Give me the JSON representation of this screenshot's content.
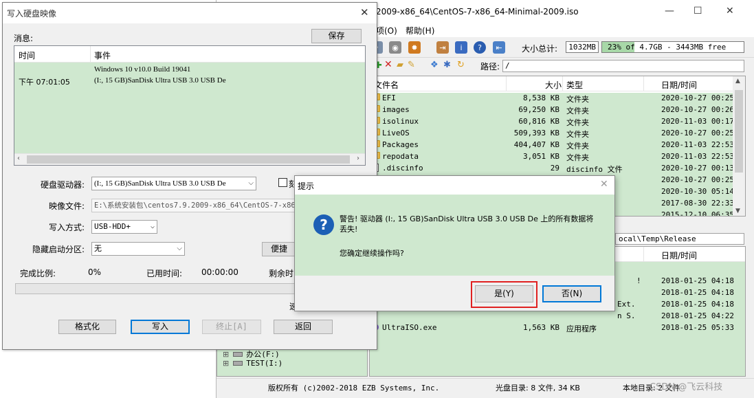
{
  "main_window": {
    "title": "2009-x86_64\\CentOS-7-x86_64-Minimal-2009.iso",
    "controls": {
      "minimize": "—",
      "maximize": "☐",
      "close": "✕"
    },
    "menu": [
      "项(O)",
      "帮助(H)"
    ],
    "size_label": "大小总计:",
    "size_value": "1032MB",
    "size_bar_text": "23% of 4.7GB - 3443MB free",
    "size_bar_fraction": 0.23,
    "path_label": "路径:",
    "path_value": "/",
    "file_columns": {
      "name": "文件名",
      "size": "大小",
      "type": "类型",
      "date": "日期/时间"
    },
    "files": [
      {
        "name": "EFI",
        "size": "8,538 KB",
        "type": "文件夹",
        "date": "2020-10-27 00:25",
        "icon": "folder-icon"
      },
      {
        "name": "images",
        "size": "69,250 KB",
        "type": "文件夹",
        "date": "2020-10-27 00:26",
        "icon": "folder-icon"
      },
      {
        "name": "isolinux",
        "size": "60,816 KB",
        "type": "文件夹",
        "date": "2020-11-03 00:17",
        "icon": "folder-icon"
      },
      {
        "name": "LiveOS",
        "size": "509,393 KB",
        "type": "文件夹",
        "date": "2020-10-27 00:25",
        "icon": "folder-icon"
      },
      {
        "name": "Packages",
        "size": "404,407 KB",
        "type": "文件夹",
        "date": "2020-11-03 22:53",
        "icon": "folder-icon"
      },
      {
        "name": "repodata",
        "size": "3,051 KB",
        "type": "文件夹",
        "date": "2020-11-03 22:53",
        "icon": "folder-icon"
      },
      {
        "name": ".discinfo",
        "size": "29",
        "type": "discinfo 文件",
        "date": "2020-10-27 00:13",
        "icon": "file-icon"
      },
      {
        "name": "",
        "size": "",
        "type": "F",
        "date": "2020-10-27 00:25",
        "icon": ""
      },
      {
        "name": "",
        "size": "",
        "type": "",
        "date": "2020-10-30 05:14",
        "icon": ""
      },
      {
        "name": "",
        "size": "",
        "type": "",
        "date": "2017-08-30 22:33",
        "icon": ""
      },
      {
        "name": "",
        "size": "",
        "type": "",
        "date": "2015-12-10 06:35",
        "icon": ""
      }
    ],
    "lower_path": "ocal\\Temp\\Release",
    "lower_date_header": "日期/时间",
    "lower_rows": [
      {
        "name": "",
        "size": "",
        "type": "!",
        "date": "2018-01-25 04:18"
      },
      {
        "name": "",
        "size": "",
        "type": "",
        "date": "2018-01-25 04:18"
      },
      {
        "name": "",
        "size": "",
        "type": "Ext.",
        "date": "2018-01-25 04:18"
      },
      {
        "name": "",
        "size": "",
        "type": "n S.",
        "date": "2018-01-25 04:22"
      },
      {
        "name": "UltraISO.exe",
        "size": "1,563 KB",
        "type": "应用程序",
        "date": "2018-01-25 05:33"
      }
    ],
    "tree": [
      "办公(F:)",
      "TEST(I:)"
    ],
    "status": {
      "copyright": "版权所有 (c)2002-2018 EZB Systems, Inc.",
      "disc_dir": "光盘目录: 8 文件, 34 KB",
      "local_dir": "本地目录: 2 文件"
    }
  },
  "write_dialog": {
    "title": "写入硬盘映像",
    "close": "✕",
    "msg_label": "消息:",
    "save_button": "保存",
    "log_columns": {
      "time": "时间",
      "event": "事件"
    },
    "log_time": "下午 07:01:05",
    "log_line1": "Windows 10 v10.0 Build 19041",
    "log_line2": "(I:, 15 GB)SanDisk Ultra USB 3.0 USB De",
    "drive_label": "硬盘驱动器:",
    "drive_value": "(I:, 15 GB)SanDisk Ultra USB 3.0 USB De",
    "verify_label": "刻",
    "image_label": "映像文件:",
    "image_value": "E:\\系统安装包\\centos7.9.2009-x86_64\\CentOS-7-x86_",
    "method_label": "写入方式:",
    "method_value": "USB-HDD+",
    "hidden_label": "隐藏启动分区:",
    "hidden_value": "无",
    "convenience_button": "便捷",
    "done_label": "完成比例:",
    "done_value": "0%",
    "elapsed_label": "已用时间:",
    "elapsed_value": "00:00:00",
    "remaining_label": "剩余时",
    "speed_label": "速",
    "progress": 0,
    "buttons": {
      "format": "格式化",
      "write": "写入",
      "stop": "终止[A]",
      "back": "返回"
    }
  },
  "confirm_dialog": {
    "title": "提示",
    "close": "✕",
    "icon": "question-icon",
    "warning": "警告! 驱动器 (I:, 15 GB)SanDisk Ultra USB 3.0 USB De 上的所有数据将丢失!",
    "question": "您确定继续操作吗?",
    "yes": "是(Y)",
    "no": "否(N)"
  },
  "watermark": "CSDN @飞云科技",
  "colors": {
    "row_green": "#cfe8cf",
    "highlight_red": "#e02020",
    "accent_blue": "#0078d7"
  }
}
